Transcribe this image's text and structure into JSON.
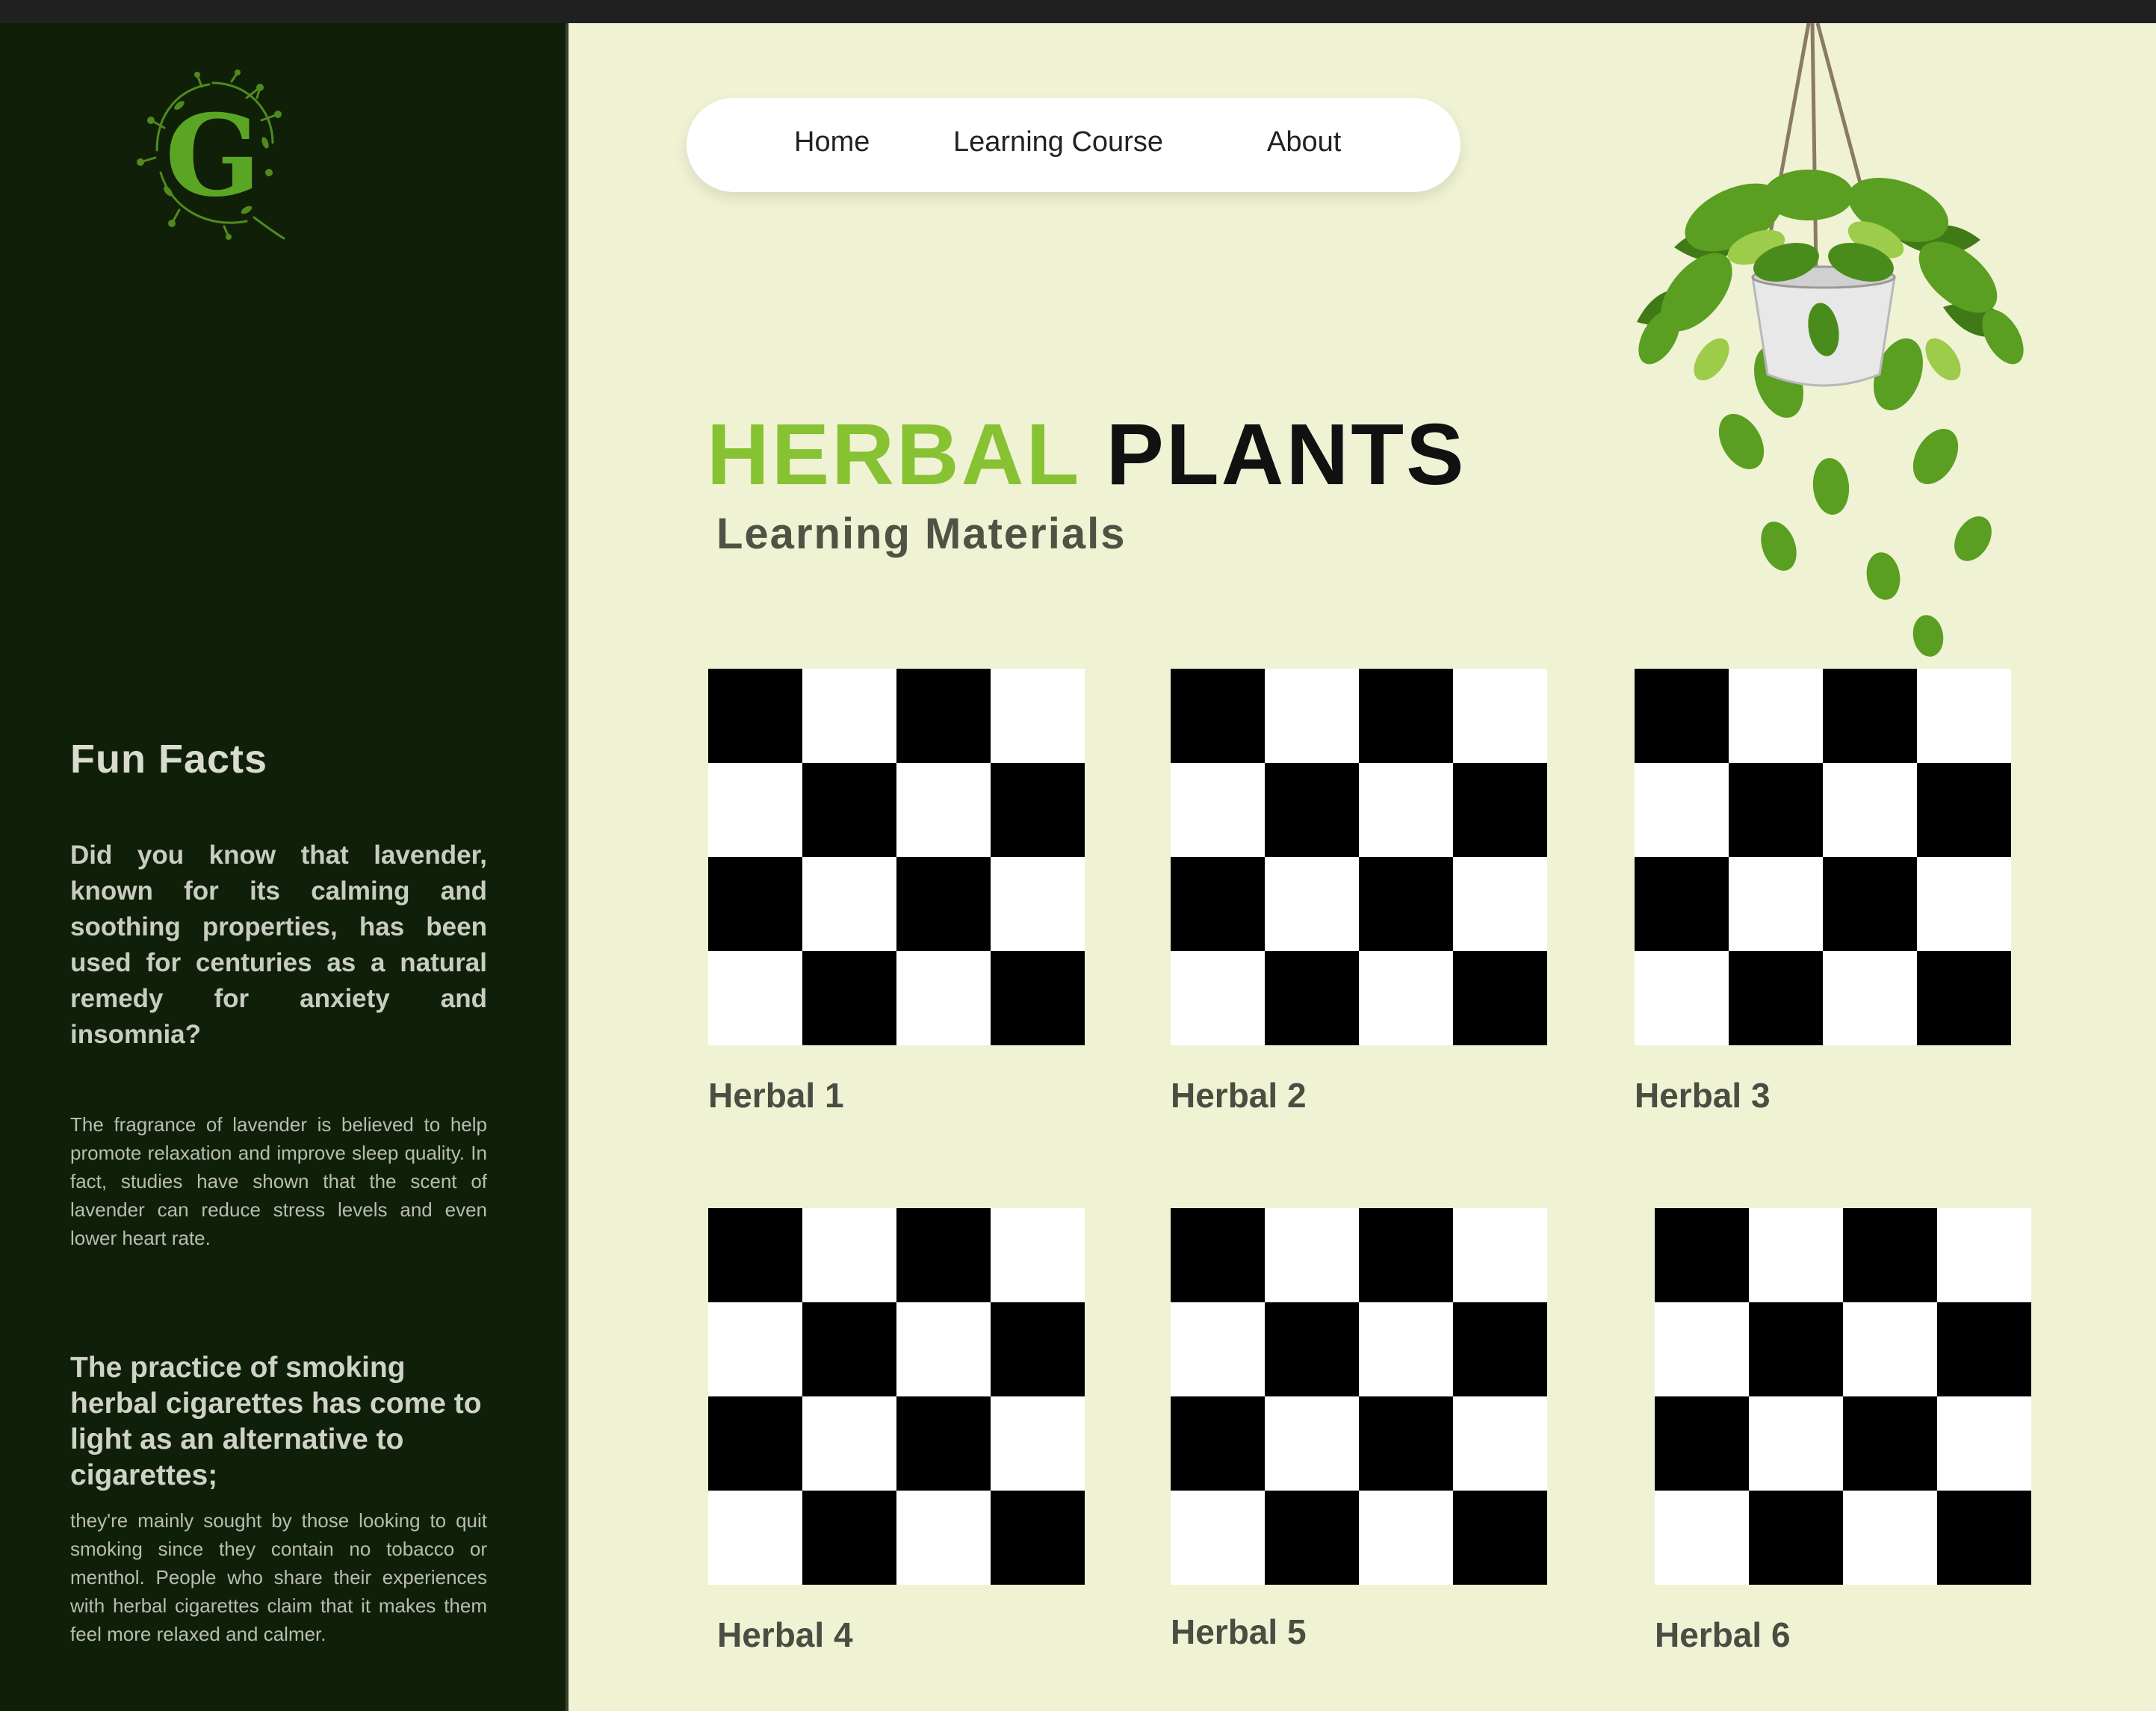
{
  "sidebar": {
    "logo_letter": "G",
    "fun_facts_title": "Fun Facts",
    "fact1_bold": "Did you know that lavender, known for its calming and soothing properties, has been used for centuries as a natural remedy for anxiety and insomnia?",
    "fact1_detail": "The fragrance of lavender is believed to help promote relaxation and improve sleep quality. In fact, studies have shown that the scent of lavender can reduce stress levels and even lower heart rate.",
    "fact2_heading": "The practice of smoking herbal cigarettes has come to light as an alternative to cigarettes;",
    "fact2_detail": "they're mainly sought by those looking to quit smoking since they contain no tobacco or menthol. People who share their experiences with herbal cigarettes claim that it makes them feel more relaxed and calmer."
  },
  "nav": {
    "items": [
      {
        "label": "Home"
      },
      {
        "label": "Learning Course"
      },
      {
        "label": "About"
      }
    ]
  },
  "hero": {
    "title_green": "HERBAL",
    "title_dark": "PLANTS",
    "subtitle": "Learning Materials"
  },
  "cards": [
    {
      "label": "Herbal 1"
    },
    {
      "label": "Herbal 2"
    },
    {
      "label": "Herbal 3"
    },
    {
      "label": "Herbal 4"
    },
    {
      "label": "Herbal 5"
    },
    {
      "label": "Herbal 6"
    }
  ],
  "colors": {
    "sidebar_bg": "#102008",
    "main_bg": "#f0f2d4",
    "accent_green": "#86c231",
    "dark_text": "#111111"
  },
  "icons": {
    "logo": "leafy-g-logo-icon",
    "plant": "hanging-plant-illustration"
  }
}
